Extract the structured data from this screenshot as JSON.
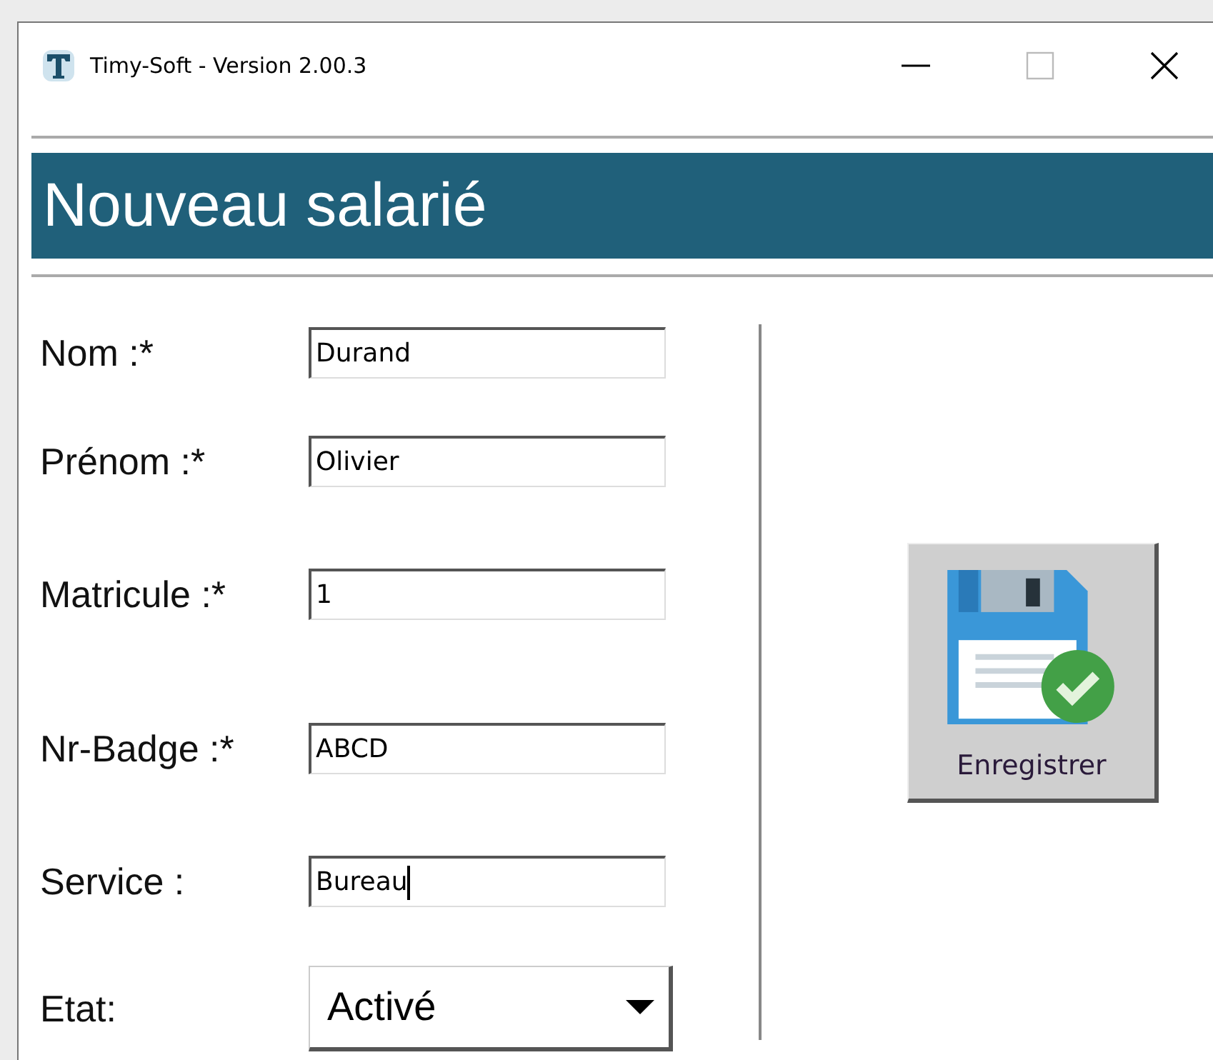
{
  "window": {
    "title": "Timy-Soft - Version 2.00.3"
  },
  "header": {
    "title": "Nouveau salarié"
  },
  "fields": [
    {
      "kind": "text",
      "label": "Nom :*",
      "value": "Durand",
      "focused": false
    },
    {
      "kind": "text",
      "label": "Prénom :*",
      "value": "Olivier",
      "focused": false
    },
    {
      "kind": "text",
      "label": "Matricule :*",
      "value": "1",
      "focused": false
    },
    {
      "kind": "text",
      "label": "Nr-Badge :*",
      "value": "ABCD",
      "focused": false
    },
    {
      "kind": "text",
      "label": "Service :",
      "value": "Bureau",
      "focused": true
    },
    {
      "kind": "dropdown",
      "label": "Etat:",
      "value": "Activé"
    }
  ],
  "save_button": {
    "label": "Enregistrer"
  }
}
